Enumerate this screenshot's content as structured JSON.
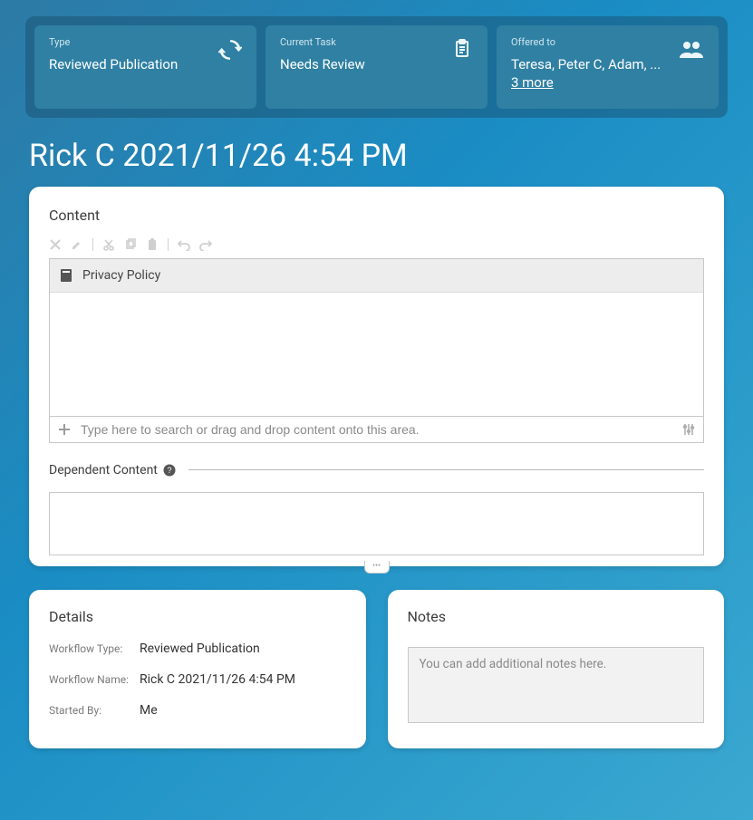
{
  "header": {
    "type": {
      "label": "Type",
      "value": "Reviewed Publication"
    },
    "task": {
      "label": "Current Task",
      "value": "Needs Review"
    },
    "offered": {
      "label": "Offered to",
      "names": "Teresa, Peter C, Adam, ... ",
      "more": "3 more"
    }
  },
  "page_title": "Rick C 2021/11/26 4:54 PM",
  "content": {
    "title": "Content",
    "item_name": "Privacy Policy",
    "search_placeholder": "Type here to search or drag and drop content onto this area."
  },
  "dependent": {
    "label": "Dependent Content"
  },
  "details": {
    "title": "Details",
    "rows": [
      {
        "label": "Workflow Type:",
        "value": "Reviewed Publication"
      },
      {
        "label": "Workflow Name:",
        "value": "Rick C 2021/11/26 4:54 PM"
      },
      {
        "label": "Started By:",
        "value": "Me"
      }
    ]
  },
  "notes": {
    "title": "Notes",
    "placeholder": "You can add additional notes here."
  }
}
